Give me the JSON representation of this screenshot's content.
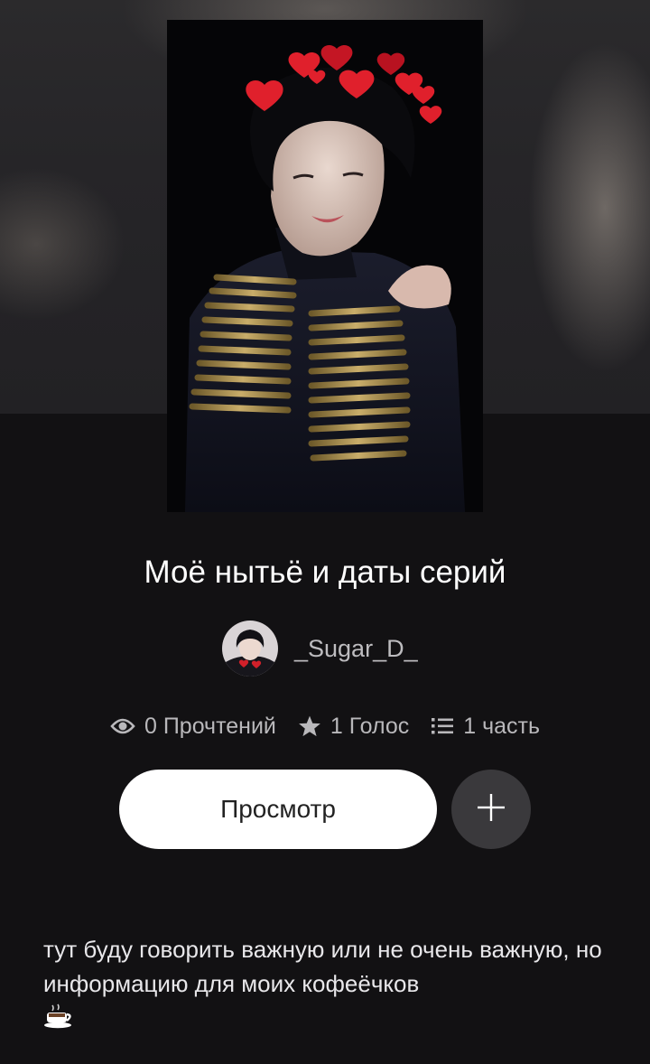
{
  "story": {
    "title": "Моё нытьё и даты серий",
    "author": "_Sugar_D_",
    "description": "тут буду говорить важную или не очень важную, но информацию для моих кофеёчков"
  },
  "stats": {
    "reads": "0 Прочтений",
    "votes": "1 Голос",
    "parts": "1 часть"
  },
  "actions": {
    "view_label": "Просмотр"
  },
  "icons": {
    "reads": "eye-icon",
    "votes": "star-icon",
    "parts": "list-icon",
    "add": "plus-icon",
    "coffee": "coffee-cup-icon"
  },
  "colors": {
    "background": "#121113",
    "header": "#262528",
    "button": "#ffffff",
    "add_button": "#3a393c",
    "stat_text": "#b9b8bb",
    "heart": "#e0202c"
  }
}
